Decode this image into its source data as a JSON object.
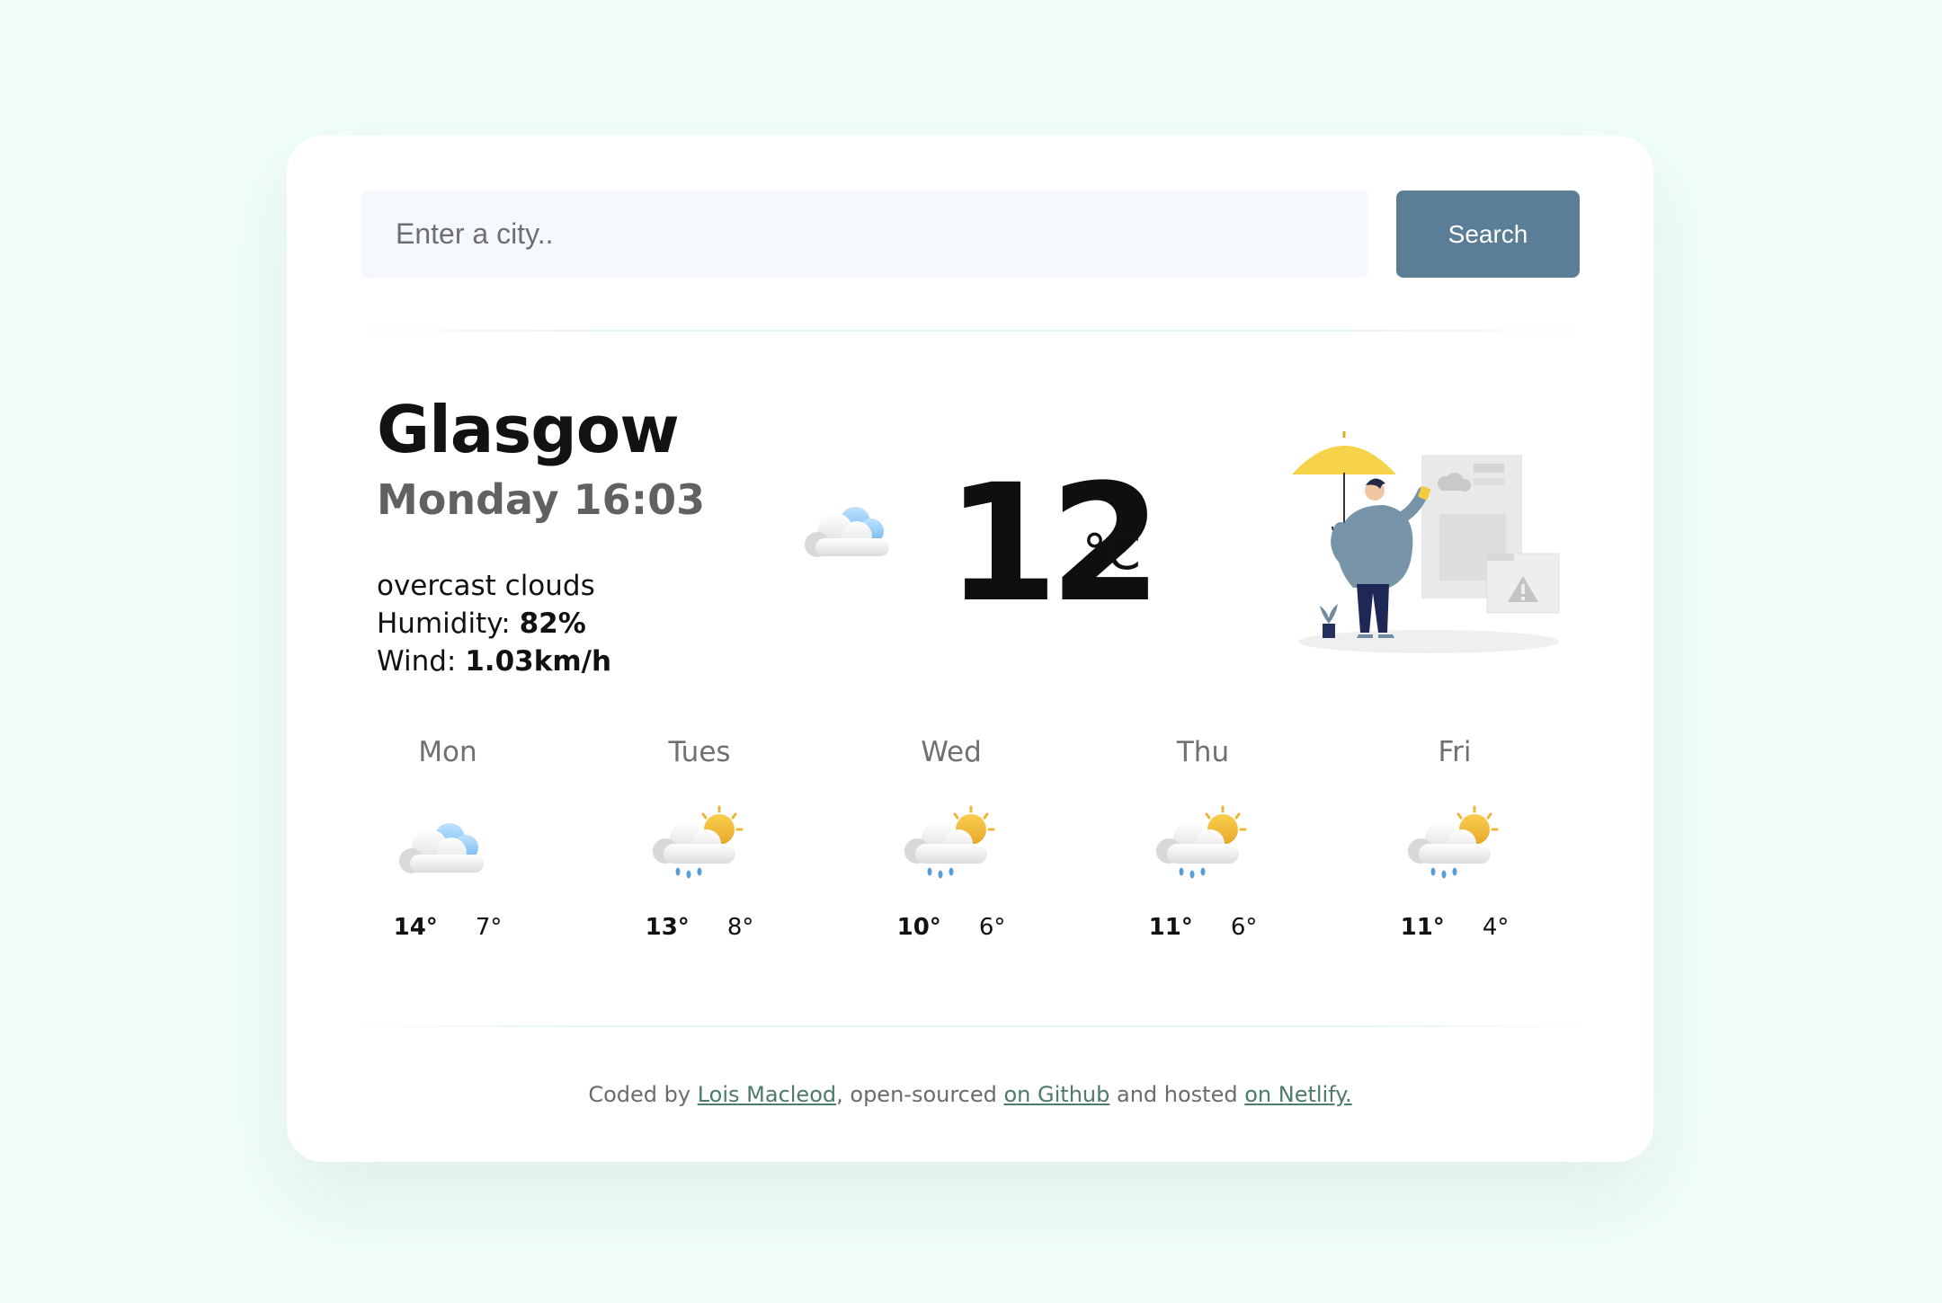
{
  "search": {
    "placeholder": "Enter a city..",
    "button_label": "Search"
  },
  "current": {
    "city": "Glasgow",
    "datetime": "Monday 16:03",
    "description": "overcast clouds",
    "humidity_label": "Humidity:",
    "humidity_value": "82%",
    "wind_label": "Wind:",
    "wind_value": "1.03km/h",
    "temperature": "12",
    "unit": "°C",
    "icon": "cloud-icon"
  },
  "forecast": [
    {
      "day": "Mon",
      "max": "14°",
      "min": "7°",
      "icon": "cloud-icon"
    },
    {
      "day": "Tues",
      "max": "13°",
      "min": "8°",
      "icon": "sun-cloud-rain-icon"
    },
    {
      "day": "Wed",
      "max": "10°",
      "min": "6°",
      "icon": "sun-cloud-rain-icon"
    },
    {
      "day": "Thu",
      "max": "11°",
      "min": "6°",
      "icon": "sun-cloud-rain-icon"
    },
    {
      "day": "Fri",
      "max": "11°",
      "min": "4°",
      "icon": "sun-cloud-rain-icon"
    }
  ],
  "footer": {
    "prefix": "Coded by ",
    "author_link": "Lois Macleod",
    "middle1": ", open-sourced ",
    "github_link": "on Github",
    "middle2": " and hosted ",
    "netlify_link": "on Netlify."
  },
  "colors": {
    "background": "#f1fef9",
    "button": "#5a7e96",
    "link": "#4c7a6b",
    "umbrella": "#f6d34a"
  }
}
